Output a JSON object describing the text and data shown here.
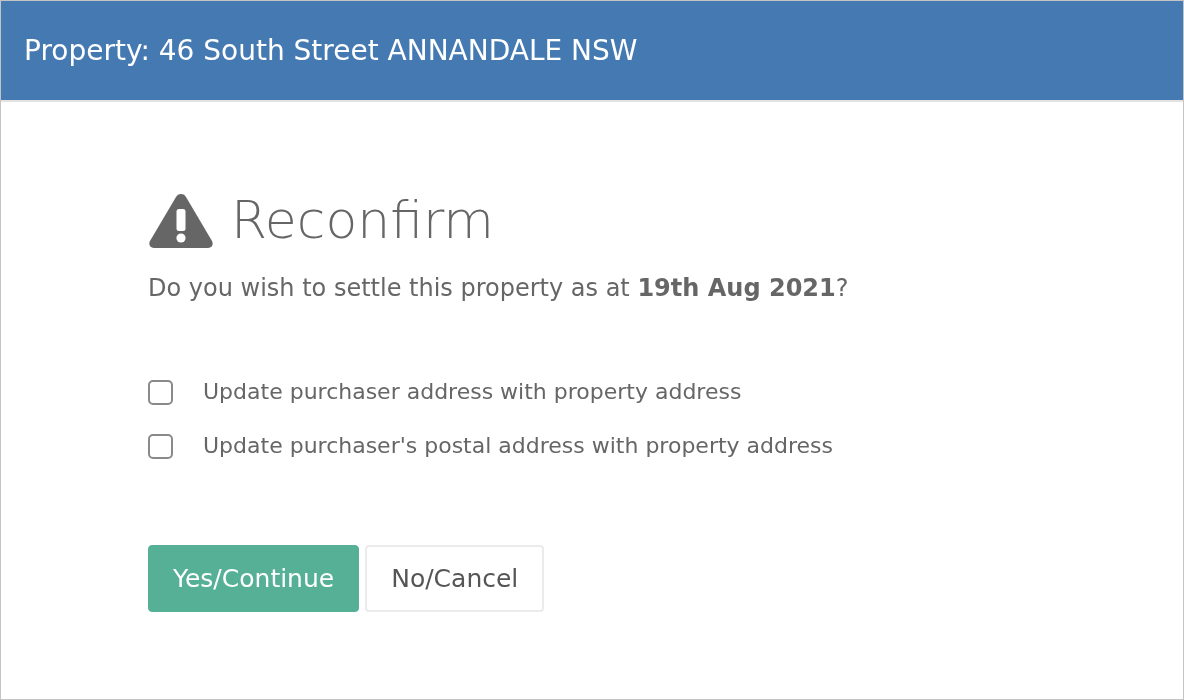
{
  "header": {
    "title": "Property: 46 South Street ANNANDALE NSW"
  },
  "dialog": {
    "heading": "Reconfirm",
    "message": "Do you wish to settle this property as at **19th Aug 2021**?",
    "options": [
      {
        "label": "Update purchaser address with property address",
        "checked": false
      },
      {
        "label": "Update purchaser's postal address with property address",
        "checked": false
      }
    ],
    "buttons": [
      {
        "label": "Yes/Continue",
        "kind": "primary"
      },
      {
        "label": "No/Cancel",
        "kind": "secondary"
      }
    ]
  }
}
